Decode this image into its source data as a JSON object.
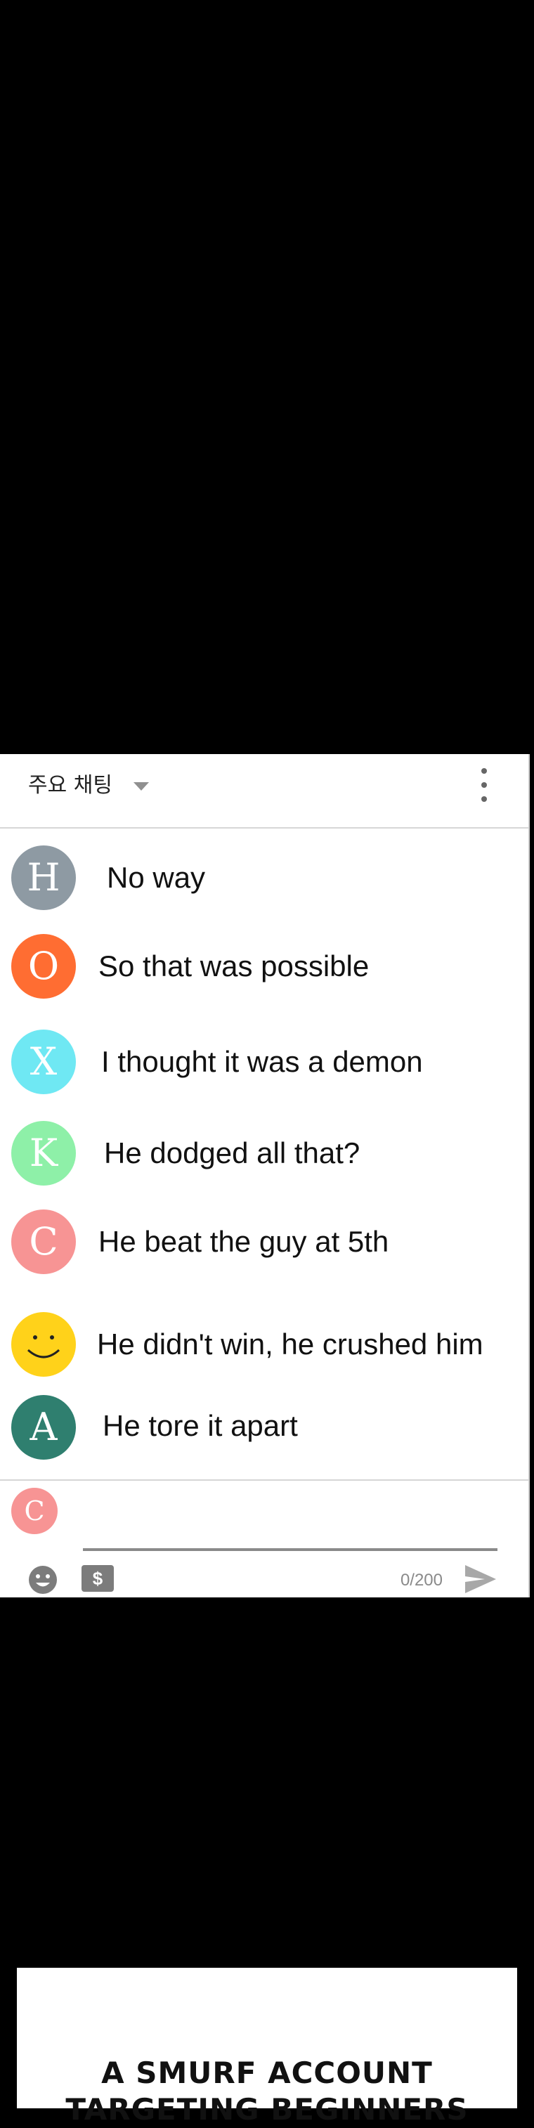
{
  "header": {
    "title": "주요 채팅"
  },
  "messages": [
    {
      "initial": "H",
      "color": "#8e9aa3",
      "text": "No way"
    },
    {
      "initial": "O",
      "color": "#ff6d32",
      "text": "So that was possible"
    },
    {
      "initial": "X",
      "color": "#6fe8f3",
      "text": "I thought it was a demon"
    },
    {
      "initial": "K",
      "color": "#8ef0a8",
      "text": "He dodged all that?"
    },
    {
      "initial": "C",
      "color": "#f79494",
      "text": "He beat the guy at 5th"
    },
    {
      "initial": "",
      "color": "#ffd21a",
      "icon": "smiley-face-icon",
      "text": "He didn't win, he crushed him"
    },
    {
      "initial": "A",
      "color": "#2f7f6f",
      "text": "He tore it apart"
    }
  ],
  "input": {
    "avatar_initial": "C",
    "avatar_color": "#f79494",
    "counter": "0/200",
    "money_symbol": "$"
  },
  "comic": {
    "caption_line1": "A SMURF ACCOUNT",
    "caption_line2": "TARGETING BEGINNERS"
  }
}
